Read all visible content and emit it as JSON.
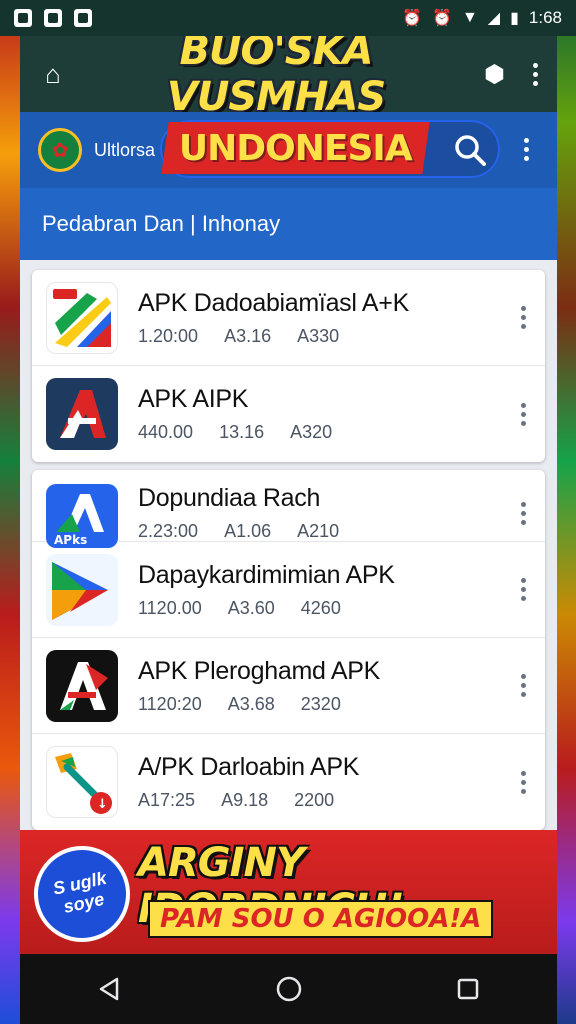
{
  "status_bar": {
    "time": "1:68"
  },
  "app_bar": {
    "title": "BUO'SKA VUSMHAS"
  },
  "search_row": {
    "brand": "Ultlorsa",
    "banner_word": "UNDONESIA"
  },
  "subheader": {
    "text": "Pedabran Dan | Inhonay"
  },
  "apps": [
    {
      "title": "APK Dadoabiamïasl A+K",
      "meta": [
        "1.20:00",
        "A3.16",
        "A330"
      ],
      "icon": "colorful-ribbon-icon"
    },
    {
      "title": "APK AIPK",
      "meta": [
        "440.00",
        "13.16",
        "A320"
      ],
      "icon": "red-a-navy-icon"
    },
    {
      "title": "Dopundiaa Rach",
      "meta": [
        "2.23:00",
        "A1.06",
        "A210"
      ],
      "icon": "blue-a-tile-icon"
    },
    {
      "title": "Dapaykardimimian APK",
      "meta": [
        "1120.00",
        "A3.60",
        "4260"
      ],
      "icon": "play-triangle-icon"
    },
    {
      "title": "APK Pleroghamd APK",
      "meta": [
        "1120:20",
        "A3.68",
        "2320"
      ],
      "icon": "black-a-red-icon"
    },
    {
      "title": "A/PK Darloabin APK",
      "meta": [
        "A17:25",
        "A9.18",
        "2200"
      ],
      "icon": "download-key-icon"
    }
  ],
  "bottom_banner": {
    "badge_line1": "S uglk",
    "badge_line2": "soye",
    "headline": "ARGINY IDORDNICH!",
    "subline": "PAM SOU O AGIOOA!A"
  },
  "colors": {
    "app_bar": "#1e3d38",
    "header_blue": "#1e5bb5",
    "accent_yellow": "#fde047",
    "accent_red": "#dc2626"
  }
}
